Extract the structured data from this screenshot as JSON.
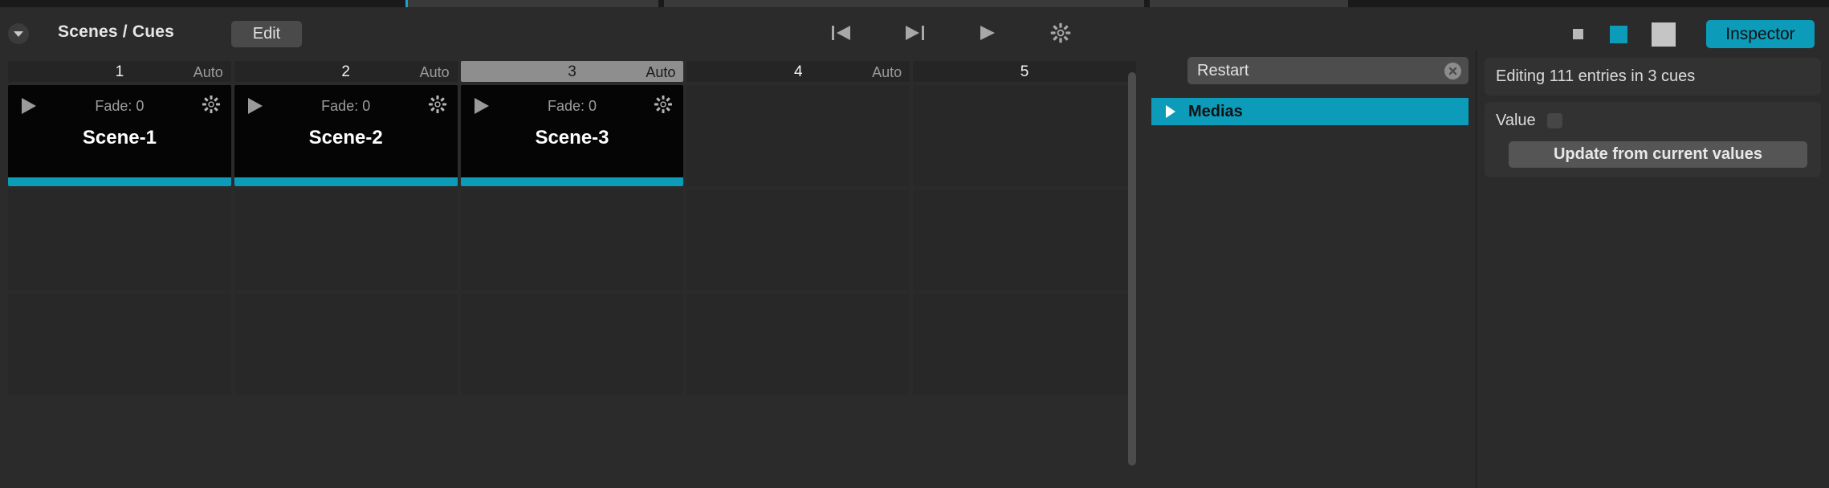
{
  "window": {
    "tabstrip_accent": "#16a6c4"
  },
  "header": {
    "collapse_icon": "chevron-down-icon",
    "title": "Scenes / Cues",
    "edit_label": "Edit",
    "transport": [
      {
        "name": "skip-back-icon",
        "label": "|◀"
      },
      {
        "name": "skip-forward-icon",
        "label": "▶|"
      },
      {
        "name": "play-icon",
        "label": "▶"
      },
      {
        "name": "gear-icon",
        "label": "⚙"
      }
    ],
    "size_buttons": [
      {
        "name": "size-small",
        "color": "#b9b9b9"
      },
      {
        "name": "size-medium",
        "color": "#0c9bb8"
      },
      {
        "name": "size-large",
        "color": "#c5c5c5"
      }
    ],
    "inspector_label": "Inspector",
    "accent": "#0c9bb8"
  },
  "grid": {
    "columns": [
      {
        "num": "1",
        "auto": "Auto",
        "selected": false
      },
      {
        "num": "2",
        "auto": "Auto",
        "selected": false
      },
      {
        "num": "3",
        "auto": "Auto",
        "selected": true
      },
      {
        "num": "4",
        "auto": "Auto",
        "selected": false
      },
      {
        "num": "5",
        "auto": "",
        "selected": false
      }
    ],
    "scenes": [
      {
        "name": "Scene-1",
        "fade": "Fade: 0",
        "bar_color": "#0c9bb8"
      },
      {
        "name": "Scene-2",
        "fade": "Fade: 0",
        "bar_color": "#0c9bb8"
      },
      {
        "name": "Scene-3",
        "fade": "Fade: 0",
        "bar_color": "#0c9bb8"
      }
    ]
  },
  "list_panel": {
    "search_value": "Restart",
    "clear_icon": "clear-circle-icon",
    "rows": [
      {
        "label": "Medias",
        "expanded": false,
        "selected": true
      }
    ]
  },
  "inspector": {
    "info": "Editing 111 entries in 3 cues",
    "value_label": "Value",
    "value_checked": false,
    "update_label": "Update from current values"
  }
}
